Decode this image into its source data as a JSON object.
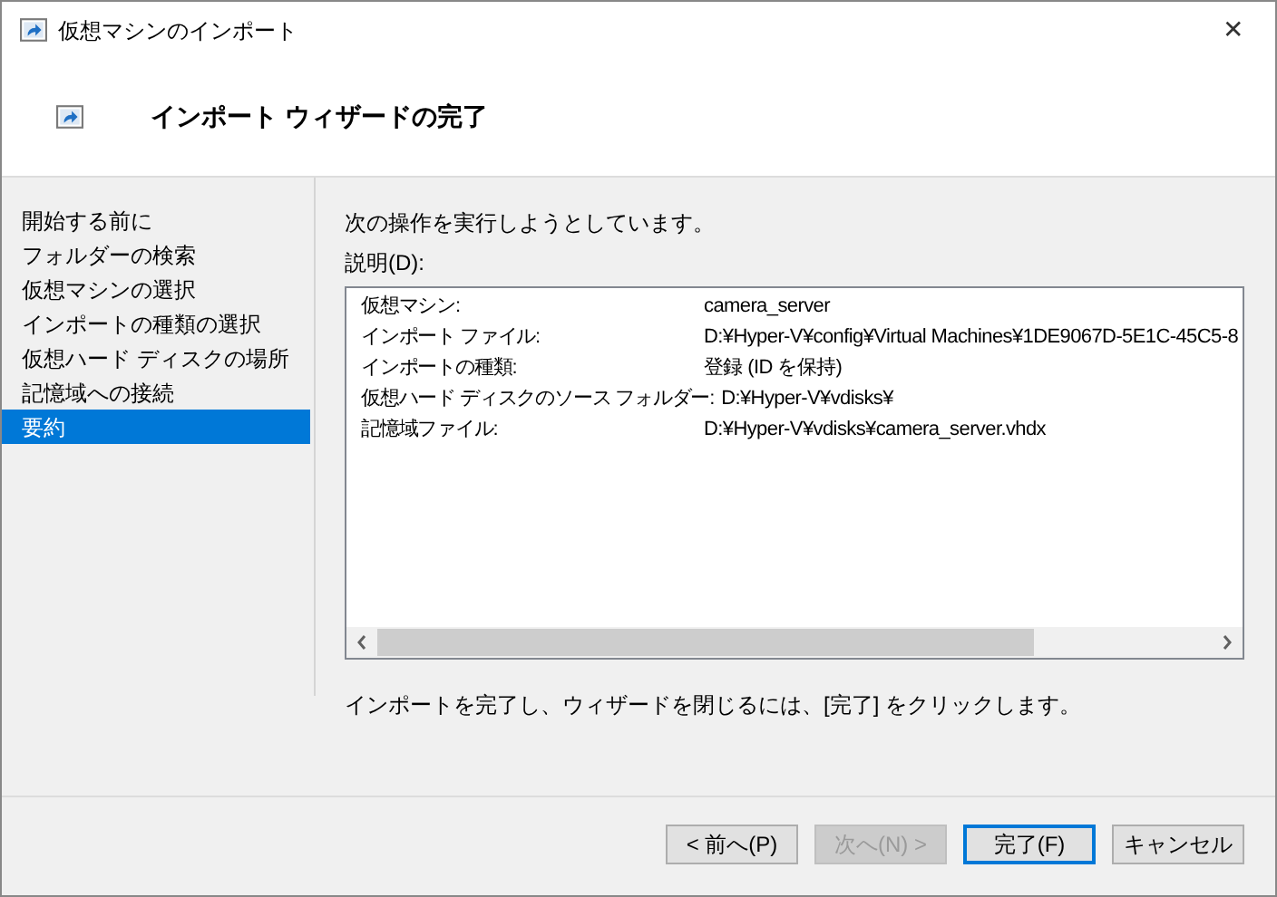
{
  "window": {
    "title": "仮想マシンのインポート",
    "close": "✕"
  },
  "header": {
    "title": "インポート ウィザードの完了"
  },
  "sidebar": {
    "items": [
      {
        "label": "開始する前に",
        "selected": false
      },
      {
        "label": "フォルダーの検索",
        "selected": false
      },
      {
        "label": "仮想マシンの選択",
        "selected": false
      },
      {
        "label": "インポートの種類の選択",
        "selected": false
      },
      {
        "label": "仮想ハード ディスクの場所",
        "selected": false
      },
      {
        "label": "記憶域への接続",
        "selected": false
      },
      {
        "label": "要約",
        "selected": true
      }
    ]
  },
  "content": {
    "intro": "次の操作を実行しようとしています。",
    "description_label": "説明(D):",
    "summary": [
      {
        "label": "仮想マシン:",
        "value": "camera_server"
      },
      {
        "label": "インポート ファイル:",
        "value": "D:¥Hyper-V¥config¥Virtual Machines¥1DE9067D-5E1C-45C5-8"
      },
      {
        "label": "インポートの種類:",
        "value": "登録 (ID を保持)"
      },
      {
        "label": "仮想ハード ディスクのソース フォルダー:",
        "value": "D:¥Hyper-V¥vdisks¥"
      },
      {
        "label": "記憶域ファイル:",
        "value": "D:¥Hyper-V¥vdisks¥camera_server.vhdx"
      }
    ],
    "note": "インポートを完了し、ウィザードを閉じるには、[完了] をクリックします。"
  },
  "buttons": [
    {
      "label": "< 前へ(P)",
      "disabled": false,
      "default": false
    },
    {
      "label": "次へ(N) >",
      "disabled": true,
      "default": false
    },
    {
      "label": "完了(F)",
      "disabled": false,
      "default": true
    },
    {
      "label": "キャンセル",
      "disabled": false,
      "default": false
    }
  ]
}
